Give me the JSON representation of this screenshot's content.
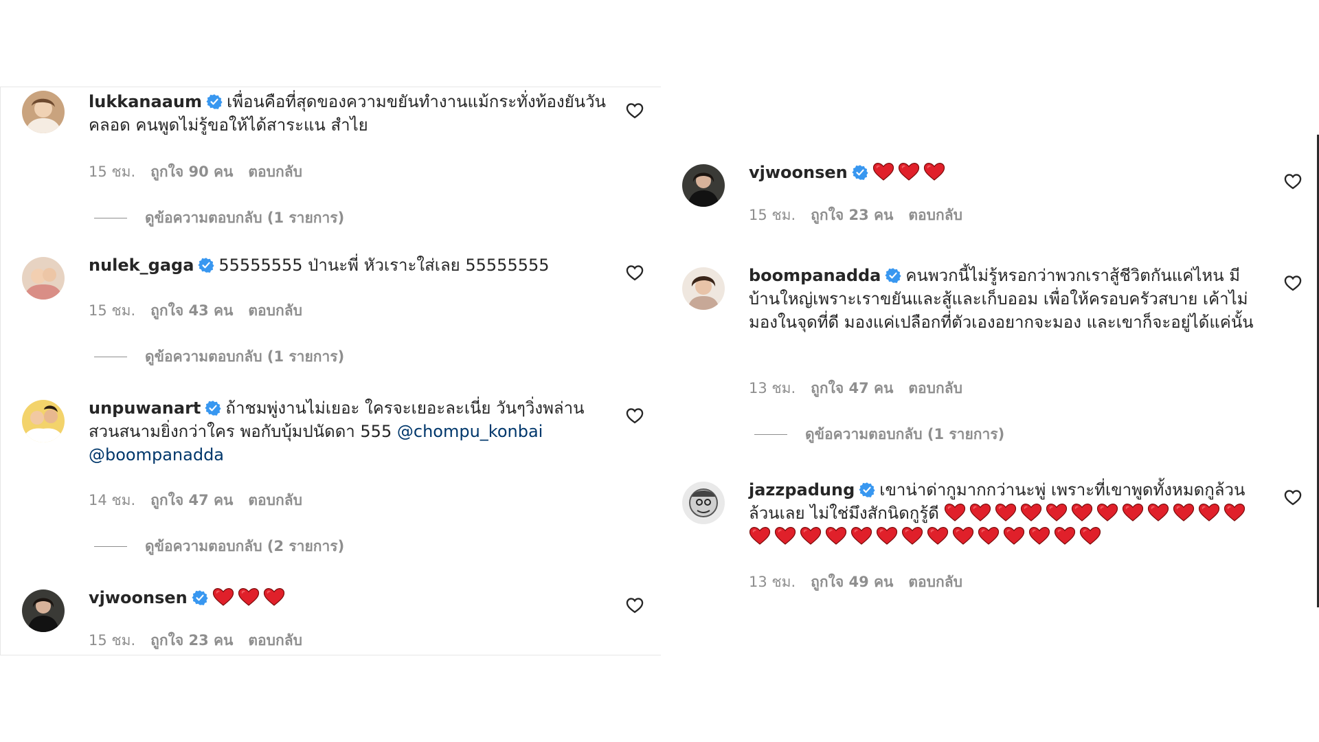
{
  "left_column": [
    {
      "username": "lukkanaaum",
      "text": "เพื่อนคือที่สุดของความขยันทำงานแม้กระทั่งท้องยันวันคลอด คนพูดไม่รู้ขอให้ได้สาระแน สำไย",
      "time": "15 ชม.",
      "likes": "ถูกใจ 90 คน",
      "reply": "ตอบกลับ",
      "view_replies": "ดูข้อความตอบกลับ (1 รายการ)"
    },
    {
      "username": "nulek_gaga",
      "text": "55555555 ป่านะพี่ หัวเราะใส่เลย 55555555",
      "time": "15 ชม.",
      "likes": "ถูกใจ 43 คน",
      "reply": "ตอบกลับ",
      "view_replies": "ดูข้อความตอบกลับ (1 รายการ)"
    },
    {
      "username": "unpuwanart",
      "text": "ถ้าชมพู่งานไม่เยอะ ใครจะเยอะละเนี่ย วันๆวิ่งพล่านสวนสนามยิ่งกว่าใคร พอกับบุ้มปนัดดา 555",
      "mention_1": "@chompu_konbai",
      "mention_2": "@boompanadda",
      "time": "14 ชม.",
      "likes": "ถูกใจ 47 คน",
      "reply": "ตอบกลับ",
      "view_replies": "ดูข้อความตอบกลับ (2 รายการ)"
    },
    {
      "username": "vjwoonsen",
      "hearts": 3,
      "time": "15 ชม.",
      "likes": "ถูกใจ 23 คน",
      "reply": "ตอบกลับ"
    }
  ],
  "right_column": [
    {
      "username": "vjwoonsen",
      "hearts": 3,
      "time": "15 ชม.",
      "likes": "ถูกใจ 23 คน",
      "reply": "ตอบกลับ"
    },
    {
      "username": "boompanadda",
      "text": "คนพวกนี้ไม่รู้หรอกว่าพวกเราสู้ชีวิตกันแค่ไหน มีบ้านใหญ่เพราะเราขยันและสู้และเก็บออม เพื่อให้ครอบครัวสบาย เค้าไม่มองในจุดที่ดี มองแค่เปลือกที่ตัวเองอยากจะมอง และเขาก็จะอยู่ได้แค่นั้น",
      "time": "13 ชม.",
      "likes": "ถูกใจ 47 คน",
      "reply": "ตอบกลับ",
      "view_replies": "ดูข้อความตอบกลับ (1 รายการ)"
    },
    {
      "username": "jazzpadung",
      "text": "เขาน่าด่ากูมากกว่านะพู่ เพราะที่เขาพูดทั้งหมดกูล้วนล้วนเลย ไม่ใช่มึงสักนิดกูรู้ดี",
      "hearts": 26,
      "time": "13 ชม.",
      "likes": "ถูกใจ 49 คน",
      "reply": "ตอบกลับ"
    }
  ],
  "icons": {
    "verified": "verified-badge-icon",
    "like": "heart-outline-icon",
    "emoji": "red-heart-emoji"
  },
  "colors": {
    "verified": "#3897f0",
    "heart_emoji": "#e0202a",
    "mention": "#00376b",
    "meta": "#8e8e8e"
  }
}
